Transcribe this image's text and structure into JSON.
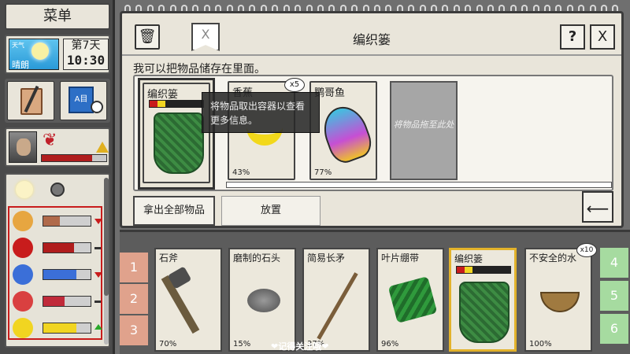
{
  "sidebar": {
    "menu_label": "菜单",
    "weather_label": "天气",
    "weather": "晴朗",
    "day": "第7天",
    "time": "10:30",
    "book_label": "A目",
    "status_bar_fill": 0.78
  },
  "dialog": {
    "title": "编织篓",
    "description": "我可以把物品储存在里面。",
    "help_label": "?",
    "close_label": "X",
    "bookmark_label": "X",
    "container": {
      "name": "编织篓"
    },
    "items": [
      {
        "name": "香蕉",
        "stack": "x5",
        "percent": "43%"
      },
      {
        "name": "鹦哥鱼",
        "percent": "77%"
      }
    ],
    "drop_slot_text": "将物品拖至此处",
    "tooltip": "将物品取出容器以查看更多信息。",
    "take_all_label": "拿出全部物品",
    "place_label": "放置"
  },
  "hotbar": {
    "left_tabs": [
      "1",
      "2",
      "3"
    ],
    "right_tabs": [
      "4",
      "5",
      "6"
    ],
    "items": [
      {
        "name": "石斧",
        "percent": "70%"
      },
      {
        "name": "磨制的石头",
        "percent": "15%"
      },
      {
        "name": "简易长矛",
        "percent": "37%"
      },
      {
        "name": "叶片绷带",
        "percent": "96%"
      },
      {
        "name": "编织篓",
        "percent": ""
      },
      {
        "name": "不安全的水",
        "percent": "100%",
        "count": "x10"
      }
    ]
  },
  "watermark": "❤记得关注哦❤",
  "colors": {
    "health_red": "#c81c1c",
    "selected_border": "#e2b22b",
    "water_blue": "#3b6fd8",
    "energy_yellow": "#f1d521"
  },
  "stats": [
    {
      "icon": "food-icon",
      "level": 0.35,
      "trend": "down"
    },
    {
      "icon": "health-icon",
      "level": 0.65,
      "trend": "steady"
    },
    {
      "icon": "water-icon",
      "level": 0.7,
      "trend": "down"
    },
    {
      "icon": "temperature-icon",
      "level": 0.45,
      "trend": "steady"
    },
    {
      "icon": "energy-icon",
      "level": 0.7,
      "trend": "up"
    }
  ]
}
